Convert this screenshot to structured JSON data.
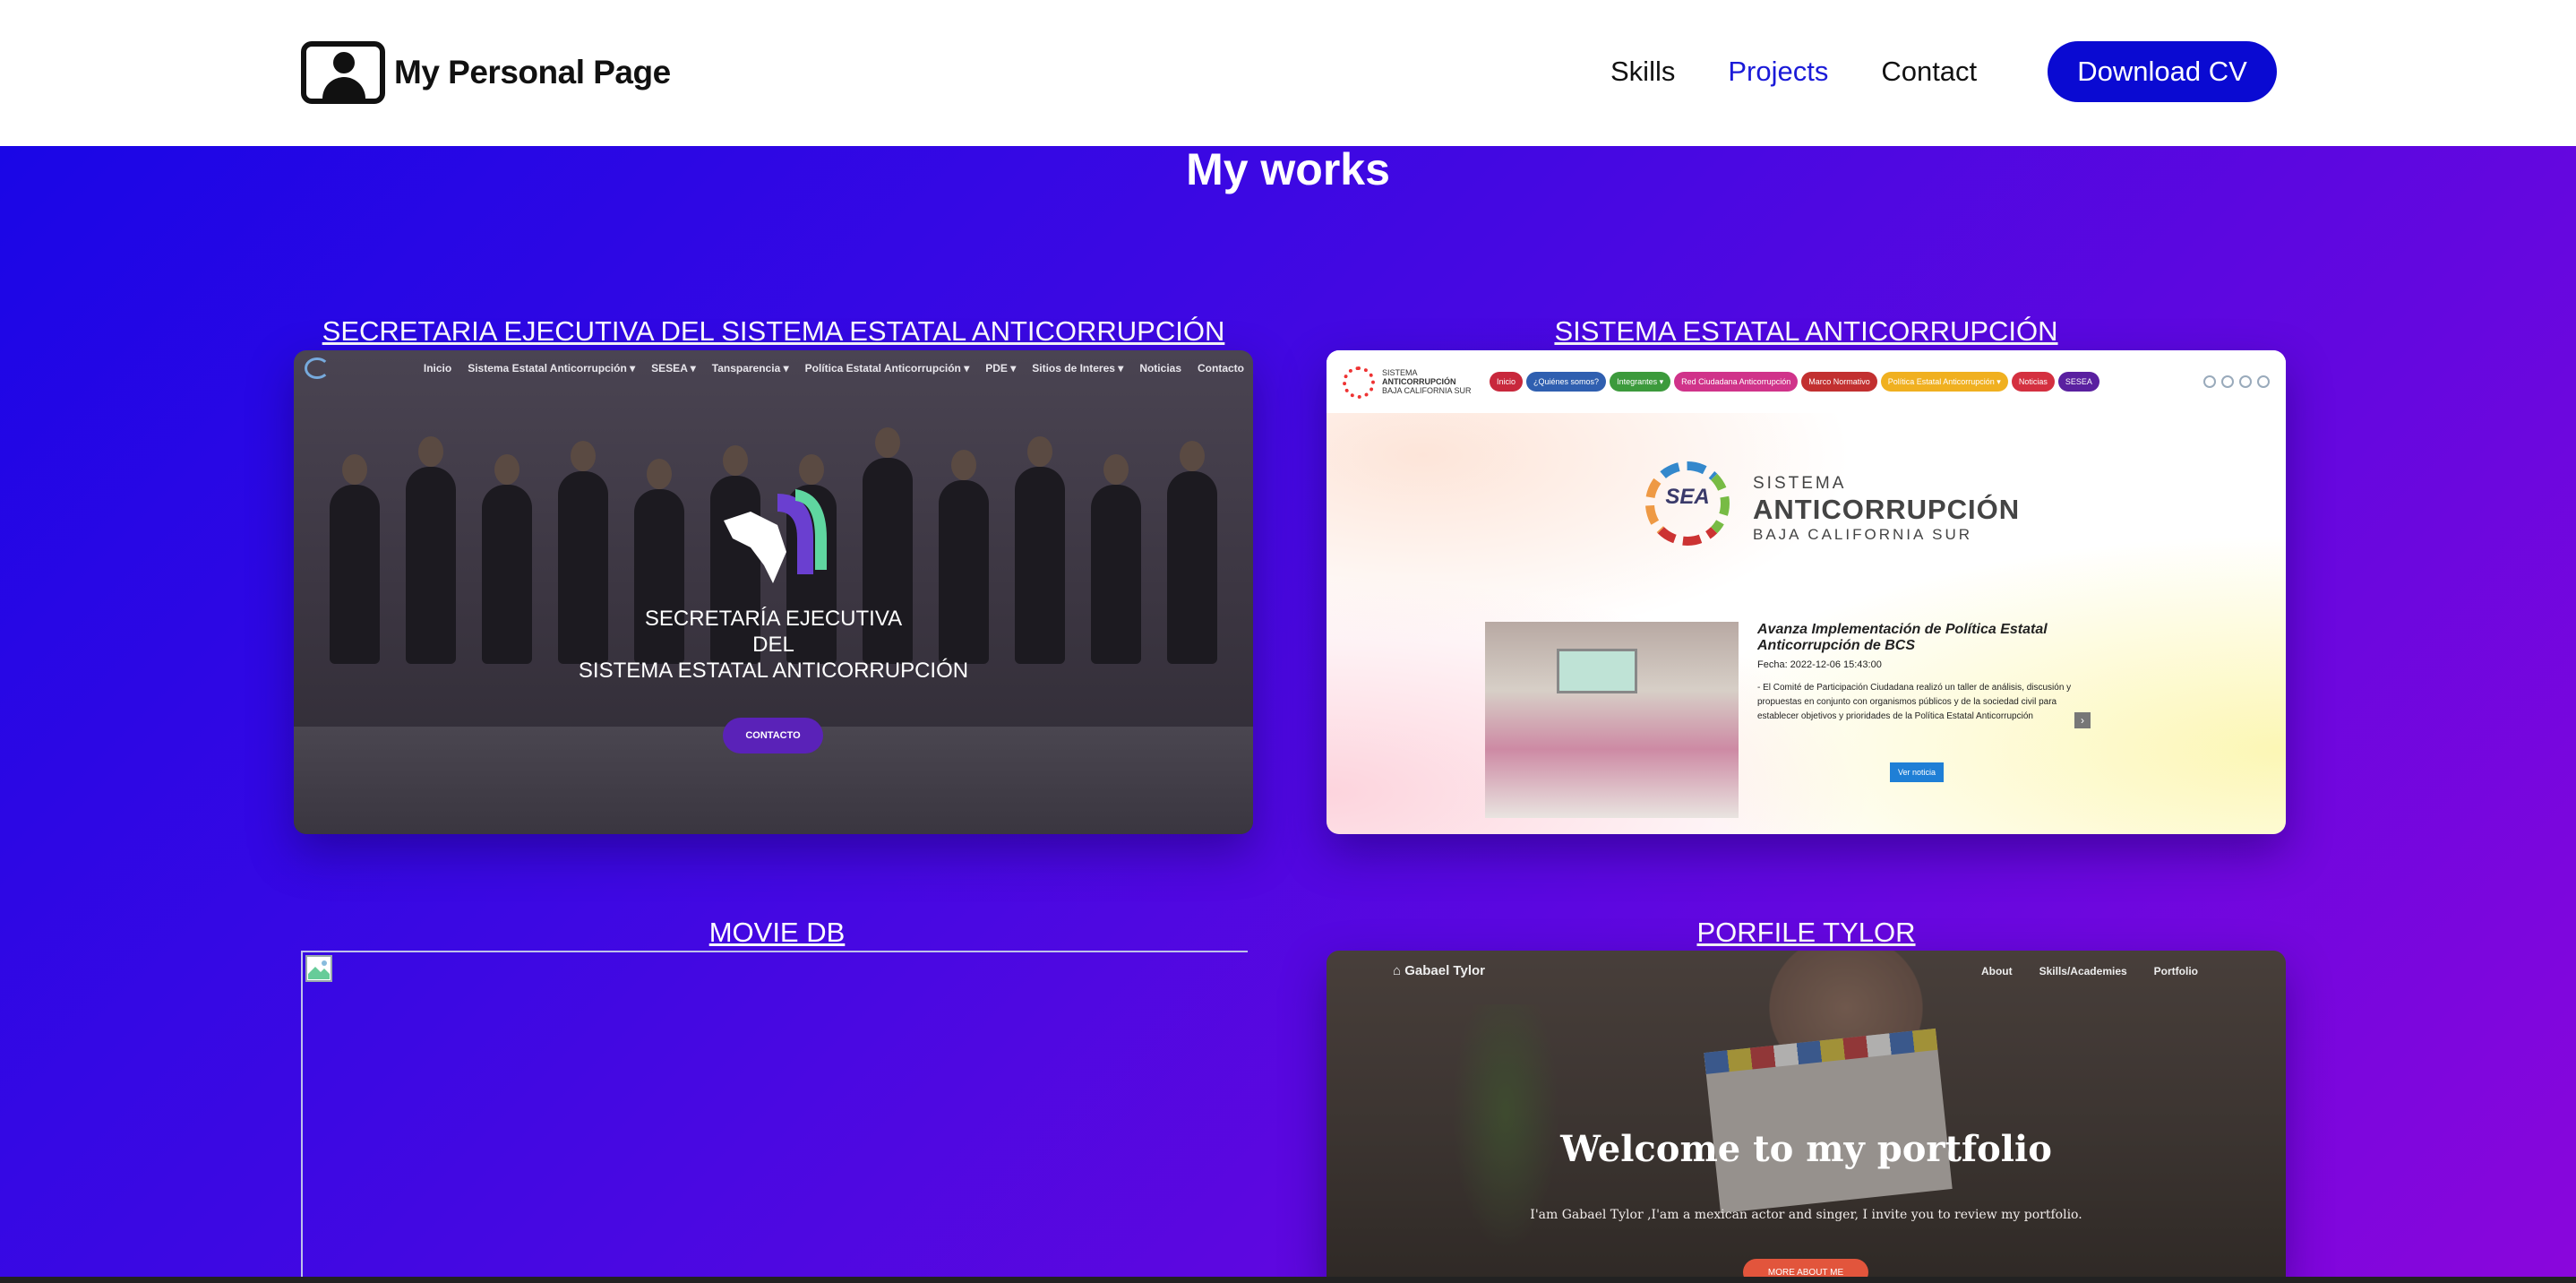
{
  "header": {
    "brand_title": "My Personal Page",
    "brand_icon": "person-frame-icon",
    "nav": [
      {
        "label": "Skills",
        "active": false
      },
      {
        "label": "Projects",
        "active": true
      },
      {
        "label": "Contact",
        "active": false
      }
    ],
    "cv_button": "Download CV"
  },
  "colors": {
    "accent_blue": "#0a0ad2",
    "active_link": "#1a1ad8",
    "gradient_start": "#1a06e6",
    "gradient_end": "#8a06dc"
  },
  "works": {
    "title": "My works",
    "projects": [
      {
        "title": "SECRETARIA EJECUTIVA DEL SISTEMA ESTATAL ANTICORRUPCIÓN",
        "preview": {
          "nav": [
            "Inicio",
            "Sistema Estatal Anticorrupción ▾",
            "SESEA ▾",
            "Tansparencia ▾",
            "Política Estatal Anticorrupción ▾",
            "PDE ▾",
            "Sitios de Interes ▾",
            "Noticias",
            "Contacto"
          ],
          "hero_line1": "SECRETARÍA EJECUTIVA",
          "hero_line2": "DEL",
          "hero_line3": "SISTEMA ESTATAL ANTICORRUPCIÓN",
          "button": "CONTACTO"
        }
      },
      {
        "title": "SISTEMA ESTATAL ANTICORRUPCIÓN",
        "preview": {
          "small_brand": [
            "SISTEMA",
            "ANTICORRUPCIÓN",
            "BAJA CALIFORNIA SUR"
          ],
          "pills": [
            {
              "label": "Inicio",
              "color": "#c8283c"
            },
            {
              "label": "¿Quiénes somos?",
              "color": "#2f5fb0"
            },
            {
              "label": "Integrantes ▾",
              "color": "#3c9a3c"
            },
            {
              "label": "Red Ciudadana Anticorrupción",
              "color": "#d0338a"
            },
            {
              "label": "Marco Normativo",
              "color": "#c23030"
            },
            {
              "label": "Política Estatal Anticorrupción ▾",
              "color": "#f0b020"
            },
            {
              "label": "Noticias",
              "color": "#d43040"
            },
            {
              "label": "SESEA",
              "color": "#5a20a0"
            }
          ],
          "logo_mark": "SEA",
          "brand_l1": "SISTEMA",
          "brand_l2": "ANTICORRUPCIÓN",
          "brand_l3": "BAJA CALIFORNIA SUR",
          "news_title": "Avanza Implementación de Política Estatal Anticorrupción de BCS",
          "news_date": "Fecha: 2022-12-06 15:43:00",
          "news_body": "- El Comité de Participación Ciudadana realizó un taller de análisis, discusión y propuestas en conjunto con organismos públicos y de la sociedad civil para establecer objetivos y prioridades de la Política Estatal Anticorrupción",
          "news_button": "Ver noticia"
        }
      },
      {
        "title": "MOVIE DB",
        "preview": {
          "broken_image_icon": "broken-image-icon"
        }
      },
      {
        "title": "PORFILE TYLOR",
        "preview": {
          "brand": "Gabael Tylor",
          "nav": [
            "About",
            "Skills/Academies",
            "Portfolio"
          ],
          "welcome": "Welcome to my portfolio",
          "subtitle": "I'am Gabael Tylor ,I'am a mexican actor and singer, I invite you to review my portfolio.",
          "button": "MORE ABOUT ME"
        }
      }
    ]
  }
}
